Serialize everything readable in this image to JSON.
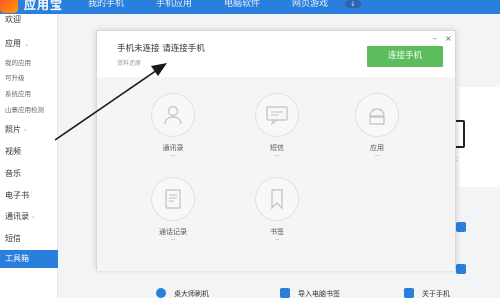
{
  "app": {
    "title": "应用宝"
  },
  "top_tabs": [
    "我的手机",
    "手机应用",
    "电脑软件",
    "网页游戏"
  ],
  "sidebar": {
    "items": [
      {
        "label": "欢迎",
        "kind": "main"
      },
      {
        "label": "应用",
        "kind": "main",
        "chevron": "⌄"
      },
      {
        "label": "我的应用",
        "kind": "sub"
      },
      {
        "label": "可升级",
        "kind": "sub"
      },
      {
        "label": "系统应用",
        "kind": "sub"
      },
      {
        "label": "山寨应用检测",
        "kind": "sub"
      },
      {
        "label": "照片",
        "kind": "main",
        "chevron": "›"
      },
      {
        "label": "视频",
        "kind": "main"
      },
      {
        "label": "音乐",
        "kind": "main"
      },
      {
        "label": "电子书",
        "kind": "main"
      },
      {
        "label": "通讯录",
        "kind": "main",
        "chevron": "›"
      },
      {
        "label": "短信",
        "kind": "main"
      },
      {
        "label": "工具箱",
        "kind": "active"
      }
    ]
  },
  "dialog": {
    "title": "手机未连接 请连接手机",
    "subtitle": "资料还原",
    "connect_button": "连接手机",
    "minimize": "–",
    "close": "×",
    "features": [
      {
        "label": "通讯录",
        "value": "--",
        "icon": "person-icon"
      },
      {
        "label": "短信",
        "value": "--",
        "icon": "message-icon"
      },
      {
        "label": "应用",
        "value": "--",
        "icon": "android-icon"
      },
      {
        "label": "通话记录",
        "value": "--",
        "icon": "call-log-icon"
      },
      {
        "label": "书签",
        "value": "--",
        "icon": "bookmark-icon"
      }
    ]
  },
  "background": {
    "right_text": "t",
    "bottom_items": [
      "桌大师刷机",
      "导入电脑书签",
      "关于手机"
    ]
  },
  "colors": {
    "topbar": "#2a7fdc",
    "connect_button": "#5cbd5c",
    "active_sidebar": "#2a7fdc"
  }
}
